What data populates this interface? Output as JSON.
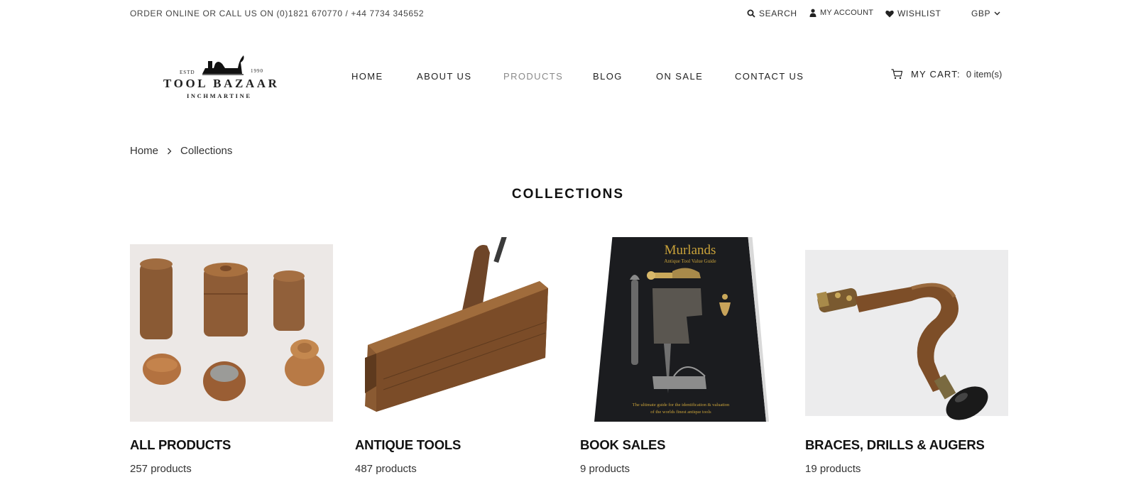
{
  "topbar": {
    "contact": "ORDER ONLINE OR CALL US ON (0)1821 670770 / +44 7734 345652",
    "search_label": "SEARCH",
    "account_label": "MY ACCOUNT",
    "wishlist_label": "WISHLIST",
    "currency": "GBP"
  },
  "logo": {
    "name": "TOOL BAZAAR",
    "subtitle": "INCHMARTINE",
    "estd": "ESTD",
    "year": "1990"
  },
  "nav": {
    "items": [
      {
        "label": "HOME"
      },
      {
        "label": "ABOUT US"
      },
      {
        "label": "PRODUCTS"
      },
      {
        "label": "BLOG"
      },
      {
        "label": "ON SALE"
      },
      {
        "label": "CONTACT US"
      }
    ],
    "active": "PRODUCTS"
  },
  "cart": {
    "label": "MY CART:",
    "count": "0 item(s)"
  },
  "breadcrumb": {
    "home": "Home",
    "current": "Collections"
  },
  "page_title": "COLLECTIONS",
  "collections": [
    {
      "title": "ALL PRODUCTS",
      "count": "257 products",
      "image": "wooden-containers"
    },
    {
      "title": "ANTIQUE TOOLS",
      "count": "487 products",
      "image": "wooden-plane"
    },
    {
      "title": "BOOK SALES",
      "count": "9 products",
      "image": "murlands-book"
    },
    {
      "title": "BRACES, DRILLS & AUGERS",
      "count": "19 products",
      "image": "wooden-brace"
    }
  ],
  "book_cover": {
    "title": "Murlands",
    "subtitle": "Antique Tool Value Guide",
    "tagline_1": "The ultimate guide for the identification & valuation",
    "tagline_2": "of the worlds finest antique tools"
  },
  "colors": {
    "text": "#222222",
    "nav_active": "#8a8a8a",
    "wood": "#8a5a34"
  }
}
